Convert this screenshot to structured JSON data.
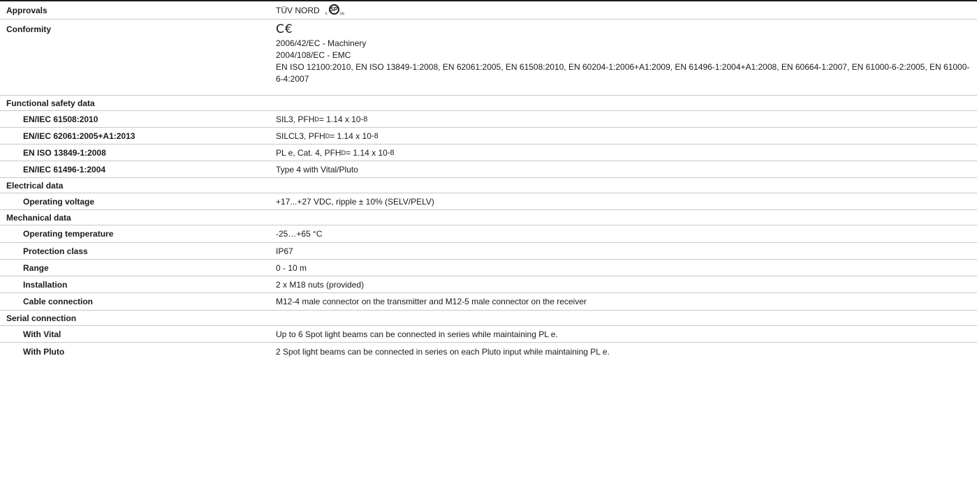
{
  "approvals": {
    "label": "Approvals",
    "tuv": "TÜV NORD",
    "csa_mark": {
      "inner": "SP",
      "left": "c",
      "right": "us"
    }
  },
  "conformity": {
    "label": "Conformity",
    "ce_mark": "C€",
    "lines": [
      "2006/42/EC - Machinery",
      "2004/108/EC - EMC",
      "EN ISO 12100:2010, EN ISO 13849-1:2008, EN 62061:2005, EN 61508:2010, EN 60204-1:2006+A1:2009, EN 61496-1:2004+A1:2008, EN 60664-1:2007, EN 61000-6-2:2005, EN 61000-6-4:2007"
    ]
  },
  "functional_safety": {
    "label": "Functional safety data",
    "rows": [
      {
        "label": "EN/IEC 61508:2010",
        "prefix": "SIL3, PFH",
        "sub": "D",
        "mid": "= 1.14 x 10",
        "sup": "-8"
      },
      {
        "label": "EN/IEC 62061:2005+A1:2013",
        "prefix": "SILCL3, PFH",
        "sub": "D",
        "mid": "= 1.14 x 10",
        "sup": "-8"
      },
      {
        "label": "EN ISO 13849-1:2008",
        "prefix": "PL e, Cat. 4, PFH",
        "sub": "D",
        "mid": "= 1.14 x 10",
        "sup": "-8"
      }
    ],
    "last": {
      "label": "EN/IEC 61496-1:2004",
      "value": "Type 4 with Vital/Pluto"
    }
  },
  "electrical": {
    "label": "Electrical data",
    "rows": [
      {
        "label": "Operating voltage",
        "value": "+17...+27 VDC, ripple ± 10% (SELV/PELV)"
      }
    ]
  },
  "mechanical": {
    "label": "Mechanical data",
    "rows": [
      {
        "label": "Operating temperature",
        "value": "-25…+65 °C"
      },
      {
        "label": "Protection class",
        "value": "IP67"
      },
      {
        "label": "Range",
        "value": "0 - 10 m"
      },
      {
        "label": "Installation",
        "value": "2 x M18 nuts (provided)"
      },
      {
        "label": "Cable connection",
        "value": "M12-4 male connector on the transmitter and M12-5 male connector on the receiver"
      }
    ]
  },
  "serial": {
    "label": "Serial connection",
    "rows": [
      {
        "label": "With Vital",
        "value": "Up to 6 Spot light beams can be connected in series while maintaining PL e."
      },
      {
        "label": "With Pluto",
        "value": "2 Spot light beams can be connected in series on each Pluto input while maintaining PL e."
      }
    ]
  }
}
